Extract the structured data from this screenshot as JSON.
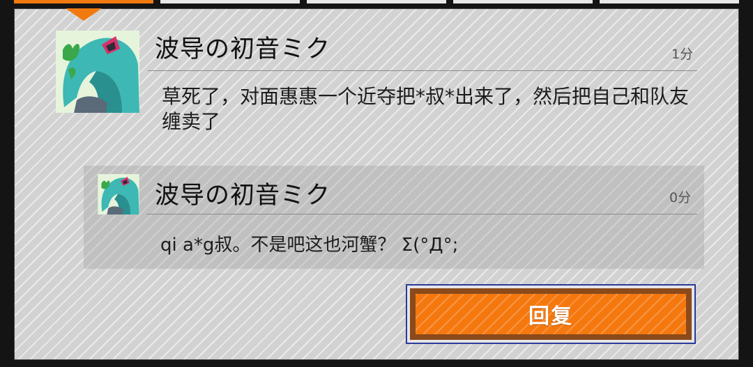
{
  "colors": {
    "accent": "#f07a10",
    "panel": "#d2d2d2",
    "button_border": "#2b3a9a"
  },
  "post": {
    "avatar_icon": "miku-avatar-icon",
    "username": "波导の初音ミク",
    "time": "1分",
    "content": "草死了，对面惠惠一个近夺把*叔*出来了，然后把自己和队友缠卖了"
  },
  "reply": {
    "avatar_icon": "miku-avatar-icon",
    "username": "波导の初音ミク",
    "time": "0分",
    "content": "qi  a*g叔。不是吧这也河蟹？ Σ(°Д°;"
  },
  "actions": {
    "reply_label": "回复"
  }
}
